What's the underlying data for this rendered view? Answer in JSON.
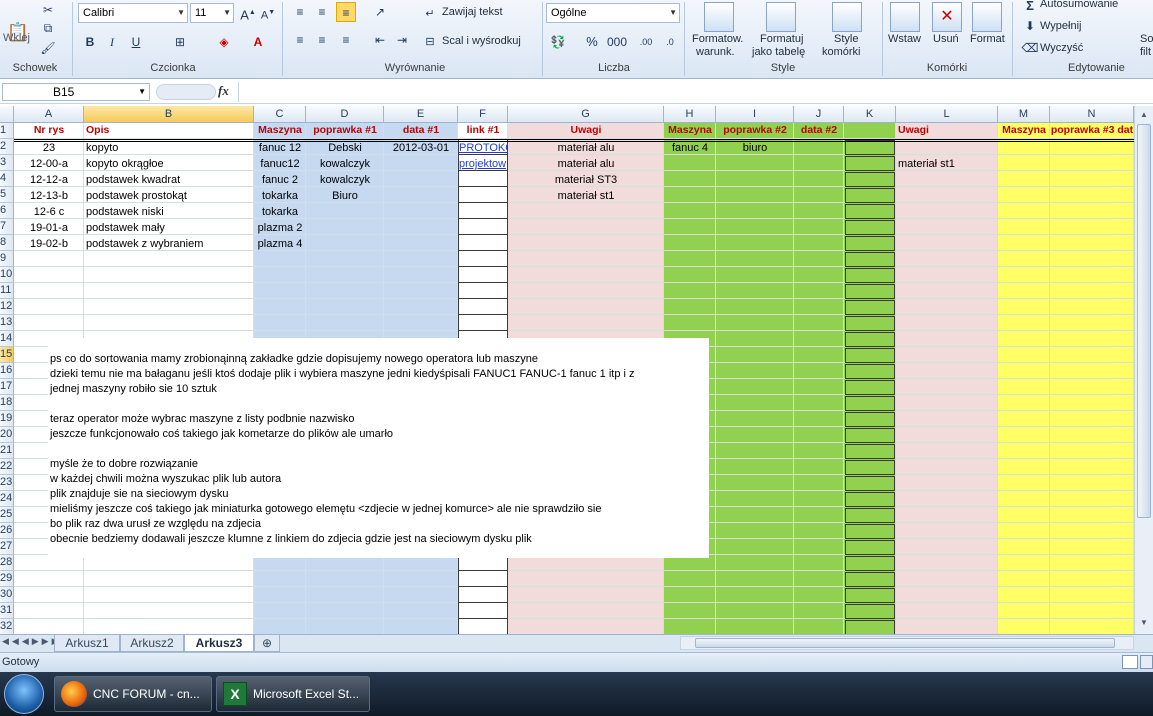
{
  "ribbon": {
    "clipboard": {
      "paste_label": "Wklej",
      "group_label": "Schowek"
    },
    "font": {
      "family": "Calibri",
      "size": "11",
      "group_label": "Czcionka",
      "bold": "B",
      "italic": "I",
      "underline": "U"
    },
    "alignment": {
      "wrap_label": "Zawijaj tekst",
      "merge_label": "Scal i wyśrodkuj",
      "group_label": "Wyrównanie"
    },
    "number": {
      "format": "Ogólne",
      "percent": "%",
      "thousands": "000",
      "group_label": "Liczba"
    },
    "style": {
      "cond_format_label_1": "Formatow.",
      "cond_format_label_2": "warunk.",
      "table_label_1": "Formatuj",
      "table_label_2": "jako tabelę",
      "cell_styles_label_1": "Style",
      "cell_styles_label_2": "komórki",
      "group_label": "Style"
    },
    "cells": {
      "insert_label": "Wstaw",
      "delete_label": "Usuń",
      "format_label": "Format",
      "group_label": "Komórki"
    },
    "editing": {
      "autosum_label": "Autosumowanie",
      "fill_label": "Wypełnij",
      "clear_label": "Wyczyść",
      "group_label": "Edytowanie",
      "sort_label_fragment_1": "So",
      "sort_label_fragment_2": "filt"
    }
  },
  "formula_bar": {
    "name_box": "B15",
    "fx": "fx",
    "value": ""
  },
  "columns": [
    "A",
    "B",
    "C",
    "D",
    "E",
    "F",
    "G",
    "H",
    "I",
    "J",
    "K",
    "L",
    "M",
    "N"
  ],
  "rows": [
    "1",
    "2",
    "3",
    "4",
    "5",
    "6",
    "7",
    "8",
    "9",
    "10",
    "11",
    "12",
    "13",
    "14",
    "15",
    "16",
    "17",
    "18",
    "19",
    "20",
    "21",
    "22",
    "23",
    "24",
    "25",
    "26",
    "27",
    "28",
    "29",
    "30",
    "31",
    "32"
  ],
  "header_row": {
    "a": "Nr rys",
    "b": "Opis",
    "c": "Maszyna",
    "d": "poprawka #1",
    "e": "data #1",
    "f": "link #1",
    "g": "Uwagi",
    "h": "Maszyna",
    "i": "poprawka #2",
    "j": "data #2",
    "l": "Uwagi",
    "m": "Maszyna",
    "n": "poprawka #3 dat"
  },
  "data_rows": [
    {
      "a": "23",
      "b": "kopyto",
      "c": "fanuc 12",
      "d": "Debski",
      "e": "2012-03-01",
      "f": "PROTOKO",
      "g": "materiał alu",
      "h": "fanuc 4",
      "i": "biuro",
      "l": ""
    },
    {
      "a": "12-00-a",
      "b": "kopyto okrągłoe",
      "c": "fanuc12",
      "d": "kowalczyk",
      "e": "",
      "f": "projektow",
      "g": "materiał alu",
      "h": "",
      "i": "",
      "l": "materiał st1"
    },
    {
      "a": "12-12-a",
      "b": "podstawek kwadrat",
      "c": "fanuc 2",
      "d": "kowalczyk",
      "e": "",
      "f": "",
      "g": "materiał ST3",
      "h": "",
      "i": "",
      "l": ""
    },
    {
      "a": "12-13-b",
      "b": "podstawek prostokąt",
      "c": "tokarka",
      "d": "Biuro",
      "e": "",
      "f": "",
      "g": "materiał st1",
      "h": "",
      "i": "",
      "l": ""
    },
    {
      "a": "12-6 c",
      "b": "podstawek niski",
      "c": "tokarka",
      "d": "",
      "e": "",
      "f": "",
      "g": "",
      "h": "",
      "i": "",
      "l": ""
    },
    {
      "a": "19-01-a",
      "b": "podstawek mały",
      "c": "plazma 2",
      "d": "",
      "e": "",
      "f": "",
      "g": "",
      "h": "",
      "i": "",
      "l": ""
    },
    {
      "a": "19-02-b",
      "b": "podstawek z wybraniem",
      "c": "plazma 4",
      "d": "",
      "e": "",
      "f": "",
      "g": "",
      "h": "",
      "i": "",
      "l": ""
    }
  ],
  "note_lines": [
    "ps co do sortowania mamy zrobionąinną zakładke gdzie dopisujemy nowego operatora lub maszyne",
    "dzieki temu nie ma bałaganu jeśli ktoś dodaje plik i wybiera maszyne jedni kiedyśpisali FANUC1 FANUC-1 fanuc 1 itp i z",
    "jednej maszyny robiło sie 10 sztuk",
    "",
    "teraz operator może wybrac maszyne z listy podbnie nazwisko",
    "jeszcze funkcjonowało coś takiego jak kometarze do plików ale umarło",
    "",
    "myśle że to dobre rozwiązanie",
    "w każdej chwili można wyszukac plik lub autora",
    "plik znajduje sie na sieciowym dysku",
    "mieliśmy jeszcze coś takiego jak miniaturka gotowego elemętu <zdjecie w jednej komurce> ale nie sprawdziło sie",
    "bo plik raz dwa urusł ze względu na zdjecia",
    "obecnie bedziemy dodawali jeszcze klumne z linkiem do zdjecia gdzie jest na sieciowym dysku plik"
  ],
  "sheet_tabs": [
    {
      "label": "Arkusz1",
      "active": false
    },
    {
      "label": "Arkusz2",
      "active": false
    },
    {
      "label": "Arkusz3",
      "active": true
    }
  ],
  "status": {
    "text": "Gotowy"
  },
  "taskbar": {
    "items": [
      {
        "label": "CNC FORUM - cn..."
      },
      {
        "label": "Microsoft Excel St..."
      }
    ]
  },
  "colors": {
    "blue_band": "#c5d9f1",
    "pink_band": "#f2dcdb",
    "green_band": "#92d050",
    "yellow_band": "#ffff66",
    "header_red": "#c00000"
  }
}
